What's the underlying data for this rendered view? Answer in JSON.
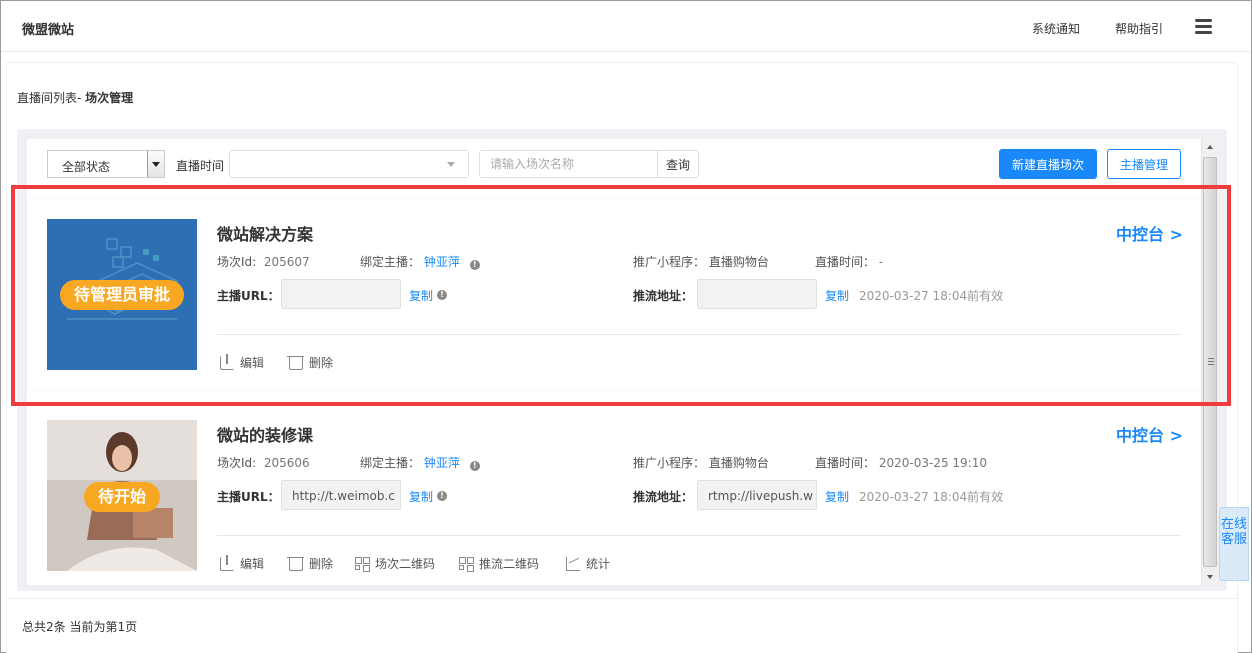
{
  "header": {
    "brand": "微盟微站",
    "nav": {
      "notice": "系统通知",
      "help": "帮助指引"
    },
    "menu_icon": "hamburger-icon"
  },
  "breadcrumb": {
    "prefix": "直播间列表- ",
    "current": "场次管理"
  },
  "filters": {
    "status_value": "全部状态",
    "time_label": "直播时间",
    "time_value": "",
    "search_placeholder": "请输入场次名称",
    "search_button": "查询",
    "new_button": "新建直播场次",
    "anchor_button": "主播管理"
  },
  "colors": {
    "accent": "#1989fa",
    "badge": "#f7a721",
    "highlight": "#f03c3c"
  },
  "sessions": [
    {
      "badge": "待管理员审批",
      "title": "微站解决方案",
      "control_link": "中控台 >",
      "id_label": "场次Id:",
      "id_value": "205607",
      "anchor_label": "绑定主播：",
      "anchor_value": "钟亚萍",
      "miniapp_label": "推广小程序：",
      "miniapp_value": "直播购物台",
      "time_label": "直播时间：",
      "time_value": "-",
      "url_label": "主播URL：",
      "url_value": "",
      "copy_label": "复制",
      "push_label": "推流地址：",
      "push_value": "",
      "copy2_label": "复制",
      "valid_text": "2020-03-27 18:04前有效",
      "actions": {
        "edit": "编辑",
        "delete": "删除"
      }
    },
    {
      "badge": "待开始",
      "title": "微站的装修课",
      "control_link": "中控台 >",
      "id_label": "场次Id:",
      "id_value": "205606",
      "anchor_label": "绑定主播：",
      "anchor_value": "钟亚萍",
      "miniapp_label": "推广小程序：",
      "miniapp_value": "直播购物台",
      "time_label": "直播时间：",
      "time_value": "2020-03-25 19:10",
      "url_label": "主播URL：",
      "url_value": "http://t.weimob.c",
      "copy_label": "复制",
      "push_label": "推流地址：",
      "push_value": "rtmp://livepush.w",
      "copy2_label": "复制",
      "valid_text": "2020-03-27 18:04前有效",
      "actions": {
        "edit": "编辑",
        "delete": "删除",
        "session_qr": "场次二维码",
        "push_qr": "推流二维码",
        "stats": "统计"
      }
    }
  ],
  "footer": {
    "summary": "总共2条 当前为第1页"
  },
  "service": {
    "label": "在线客服"
  }
}
